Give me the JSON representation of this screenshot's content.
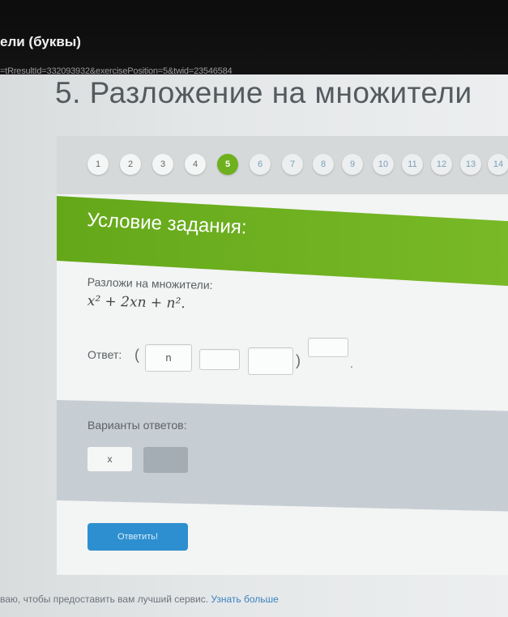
{
  "browser": {
    "tab_title": "ели (буквы)",
    "url": "=tRresultId=332093932&exercisePosition=5&twid=23546584"
  },
  "page": {
    "heading": "5. Разложение на множители"
  },
  "pager": {
    "items": [
      "1",
      "2",
      "3",
      "4",
      "5",
      "6",
      "7",
      "8",
      "9",
      "10",
      "11",
      "12",
      "13",
      "14"
    ],
    "active": "5"
  },
  "task": {
    "banner": "Условие задания:",
    "prompt": "Разложи на множители:",
    "formula": "x² + 2xn + n².",
    "answer_label": "Ответ:",
    "open_paren": "(",
    "close_paren": ")",
    "slot1_value": "n",
    "slot2_value": "",
    "slot3_value": "",
    "exponent_value": "",
    "trailing": "."
  },
  "variants": {
    "label": "Варианты ответов:",
    "options": [
      "x",
      ""
    ]
  },
  "submit": {
    "label": "Ответить!"
  },
  "cookie_notice": {
    "text": "ваю, чтобы предоставить вам лучший сервис.",
    "link": "Узнать больше"
  },
  "colors": {
    "accent_green": "#6fb01e",
    "button_blue": "#2d8fcf"
  }
}
